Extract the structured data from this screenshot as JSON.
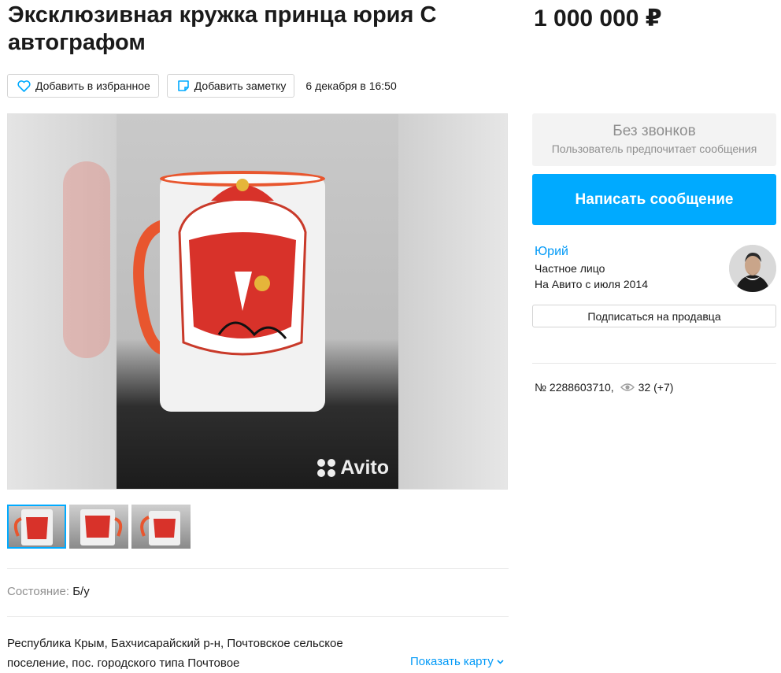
{
  "listing": {
    "title": "Эксклюзивная кружка принца юрия С автографом",
    "price": "1 000 000 ₽",
    "date": "6 декабря в 16:50",
    "id_label": "№ 2288603710,",
    "views": "32 (+7)"
  },
  "actions": {
    "favorite_label": "Добавить в избранное",
    "note_label": "Добавить заметку"
  },
  "gallery": {
    "watermark": "Avito",
    "thumbnail_count": 3
  },
  "params": {
    "condition_key": "Состояние:",
    "condition_value": "Б/у"
  },
  "location": {
    "address": "Республика Крым, Бахчисарайский р-н, Почтовское сельское поселение, пос. городского типа Почтовое",
    "map_link": "Показать карту"
  },
  "contact": {
    "no_calls_title": "Без звонков",
    "no_calls_subtitle": "Пользователь предпочитает сообщения",
    "message_button": "Написать сообщение",
    "subscribe_button": "Подписаться на продавца"
  },
  "seller": {
    "name": "Юрий",
    "type": "Частное лицо",
    "since": "На Авито с июля 2014"
  },
  "colors": {
    "accent": "#00aaff",
    "link": "#0099f7",
    "muted": "#8f8f8f"
  }
}
